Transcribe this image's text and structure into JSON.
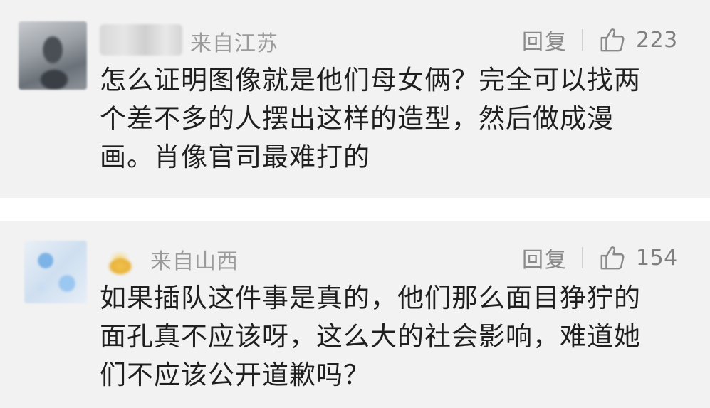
{
  "comments": [
    {
      "location": "来自江苏",
      "reply_label": "回复",
      "like_icon": "thumbs-up-icon",
      "like_count": "223",
      "text_lines": [
        "怎么证明图像就是他们母女俩？完全可以找两",
        "个差不多的人摆出这样的造型，然后做成漫",
        "画。肖像官司最难打的"
      ]
    },
    {
      "location": "来自山西",
      "reply_label": "回复",
      "like_icon": "thumbs-up-icon",
      "like_count": "154",
      "text_lines": [
        "如果插队这件事是真的，他们那么面目狰狞的",
        "面孔真不应该呀，这么大的社会影响，难道她",
        "们不应该公开道歉吗？"
      ]
    }
  ],
  "colors": {
    "card_background": "#f2f2f2",
    "meta_text": "#9b9b9b",
    "body_text": "#1f1f1f"
  }
}
